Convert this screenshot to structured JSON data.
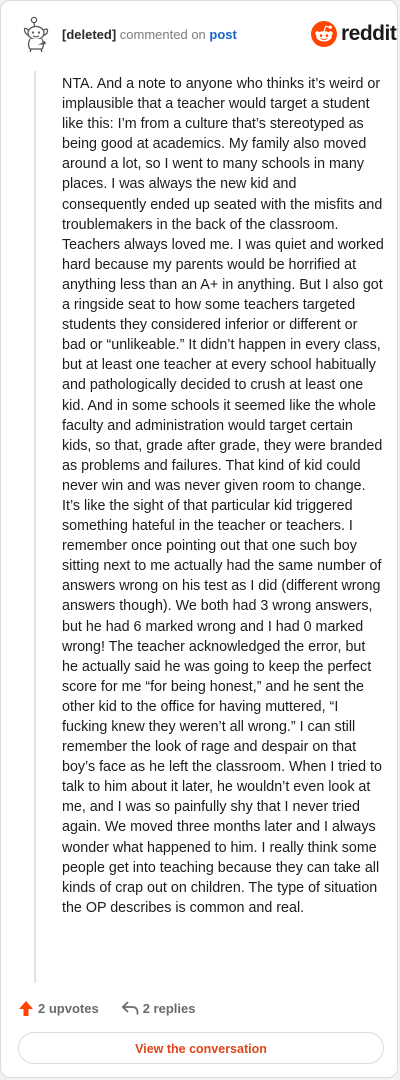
{
  "comment": {
    "author": "[deleted]",
    "action": "commented on",
    "target": "post",
    "body": "NTA. And a note to anyone who thinks it’s weird or implausible that a teacher would target a student like this: I’m from a culture that’s stereotyped as being good at academics. My family also moved around a lot, so I went to many schools in many places. I was always the new kid and consequently ended up seated with the misfits and troublemakers in the back of the classroom. Teachers always loved me. I was quiet and worked hard because my parents would be horrified at anything less than an A+ in anything. But I also got a ringside seat to how some teachers targeted students they considered inferior or different or bad or “unlikeable.” It didn’t happen in every class, but at least one teacher at every school habitually and pathologically decided to crush at least one kid. And in some schools it seemed like the whole faculty and administration would target certain kids, so that, grade after grade, they were branded as problems and failures. That kind of kid could never win and was never given room to change. It’s like the sight of that particular kid triggered something hateful in the teacher or teachers. I remember once pointing out that one such boy sitting next to me actually had the same number of answers wrong on his test as I did (different wrong answers though). We both had 3 wrong answers, but he had 6 marked wrong and I had 0 marked wrong! The teacher acknowledged the error, but he actually said he was going to keep the perfect score for me “for being honest,” and he sent the other kid to the office for having muttered, “I fucking knew they weren’t all wrong.” I can still remember the look of rage and despair on that boy’s face as he left the classroom. When I tried to talk to him about it later, he wouldn’t even look at me, and I was so painfully shy that I never tried again. We moved three months later and I always wonder what happened to him. I really think some people get into teaching because they can take all kinds of crap out on children. The type of situation the OP describes is common and real."
  },
  "brand": {
    "name": "reddit",
    "icon": "reddit-logo-icon",
    "color": "#ff4500"
  },
  "footer": {
    "upvotes": "2 upvotes",
    "upvote_icon": "upvote-arrow-icon",
    "replies": "2 replies",
    "reply_icon": "reply-arrow-icon"
  },
  "cta": {
    "label": "View the conversation",
    "color": "#e0451b"
  }
}
